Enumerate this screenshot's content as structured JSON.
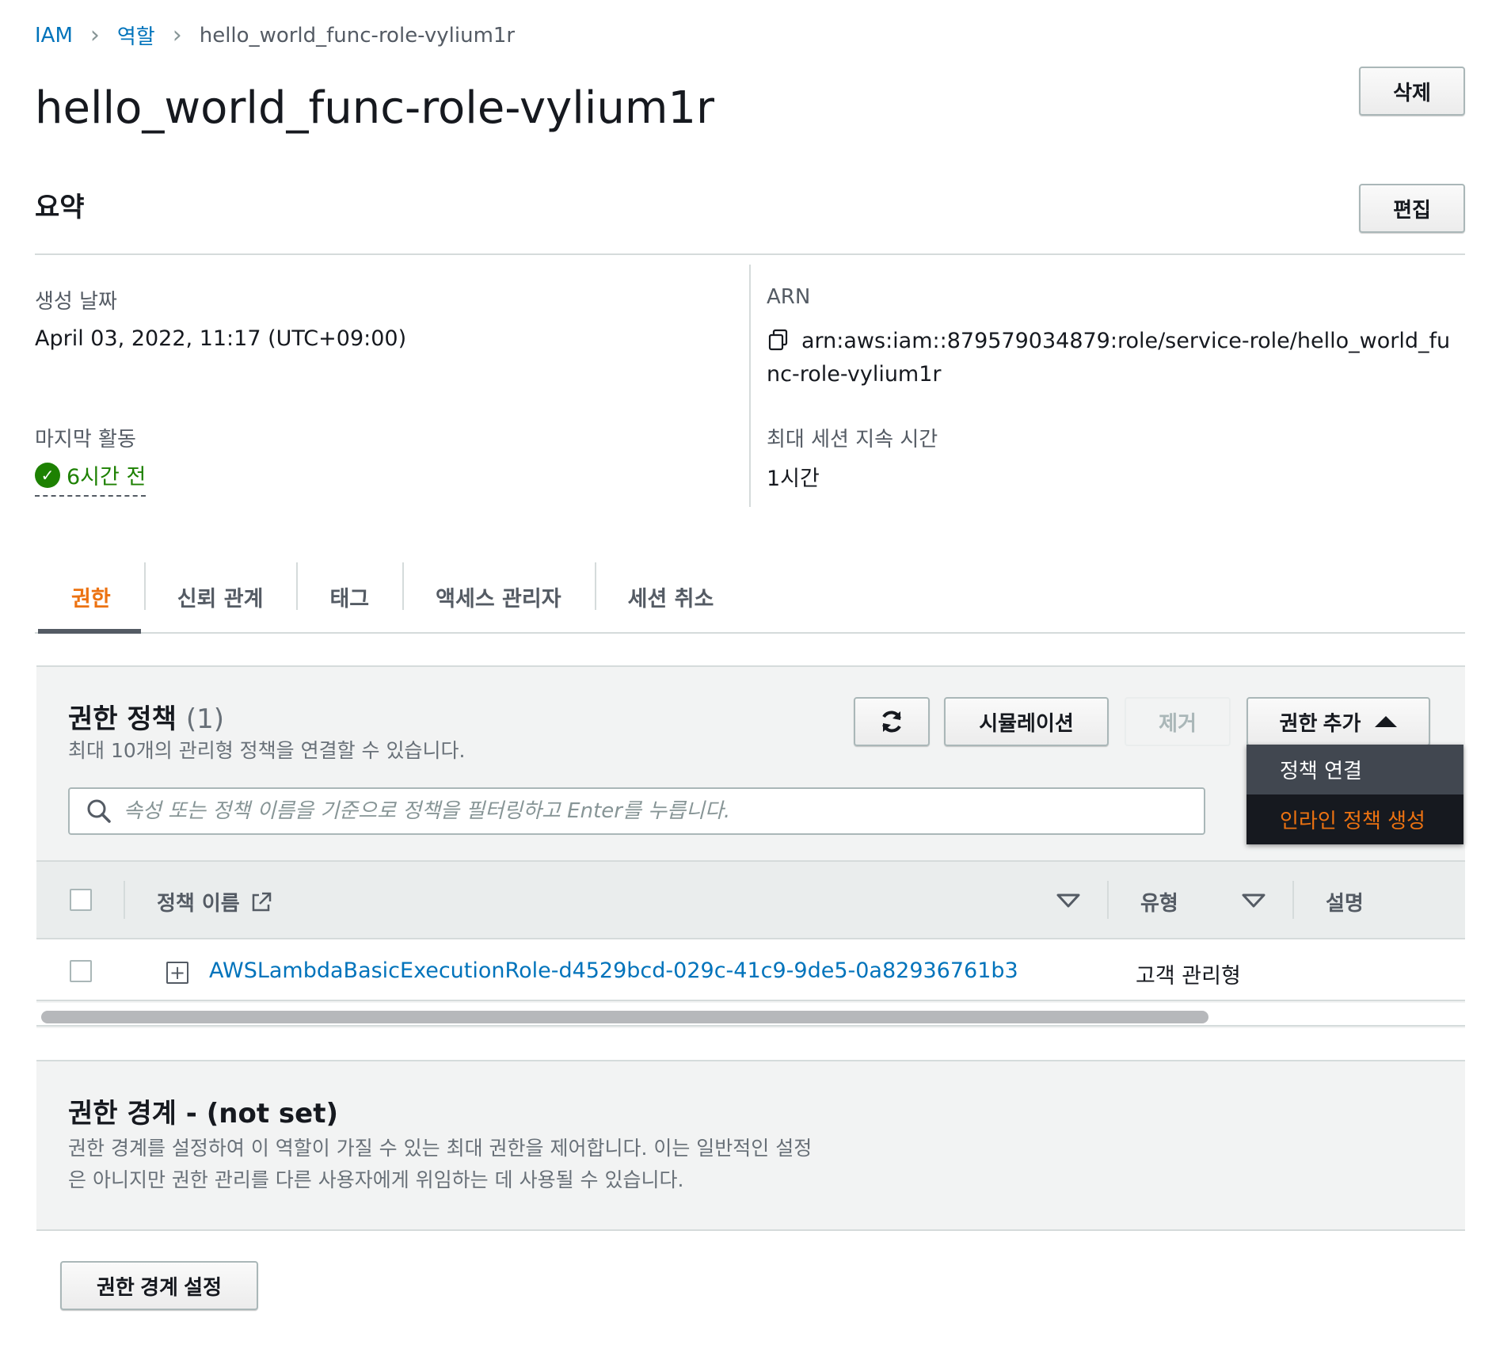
{
  "breadcrumb": {
    "iam": "IAM",
    "roles": "역할",
    "current": "hello_world_func-role-vylium1r"
  },
  "page": {
    "title": "hello_world_func-role-vylium1r",
    "delete_label": "삭제"
  },
  "summary": {
    "title": "요약",
    "edit_label": "편집",
    "created_label": "생성 날짜",
    "created_value": "April 03, 2022, 11:17 (UTC+09:00)",
    "last_activity_label": "마지막 활동",
    "last_activity_value": "6시간 전",
    "arn_label": "ARN",
    "arn_value": "arn:aws:iam::879579034879:role/service-role/hello_world_func-role-vylium1r",
    "max_session_label": "최대 세션 지속 시간",
    "max_session_value": "1시간"
  },
  "tabs": [
    {
      "label": "권한",
      "active": true
    },
    {
      "label": "신뢰 관계"
    },
    {
      "label": "태그"
    },
    {
      "label": "액세스 관리자"
    },
    {
      "label": "세션 취소"
    }
  ],
  "policies": {
    "title": "권한 정책",
    "count": "(1)",
    "subtitle": "최대 10개의 관리형 정책을 연결할 수 있습니다.",
    "simulate_label": "시뮬레이션",
    "remove_label": "제거",
    "add_label": "권한 추가",
    "search_placeholder": "속성 또는 정책 이름을 기준으로 정책을 필터링하고 Enter를 누릅니다.",
    "menu": [
      "정책 연결",
      "인라인 정책 생성"
    ],
    "columns": {
      "name": "정책 이름",
      "type": "유형",
      "description": "설명"
    },
    "rows": [
      {
        "name": "AWSLambdaBasicExecutionRole-d4529bcd-029c-41c9-9de5-0a82936761b3",
        "type": "고객 관리형"
      }
    ]
  },
  "boundary": {
    "title": "권한 경계 - (not set)",
    "desc_line1": "권한 경계를 설정하여 이 역할이 가질 수 있는 최대 권한을 제어합니다. 이는 일반적인 설정",
    "desc_line2": "은 아니지만 권한 관리를 다른 사용자에게 위임하는 데 사용될 수 있습니다.",
    "set_label": "권한 경계 설정"
  },
  "colors": {
    "link": "#0073bb",
    "accent": "#ec7211",
    "success": "#1d8102"
  }
}
